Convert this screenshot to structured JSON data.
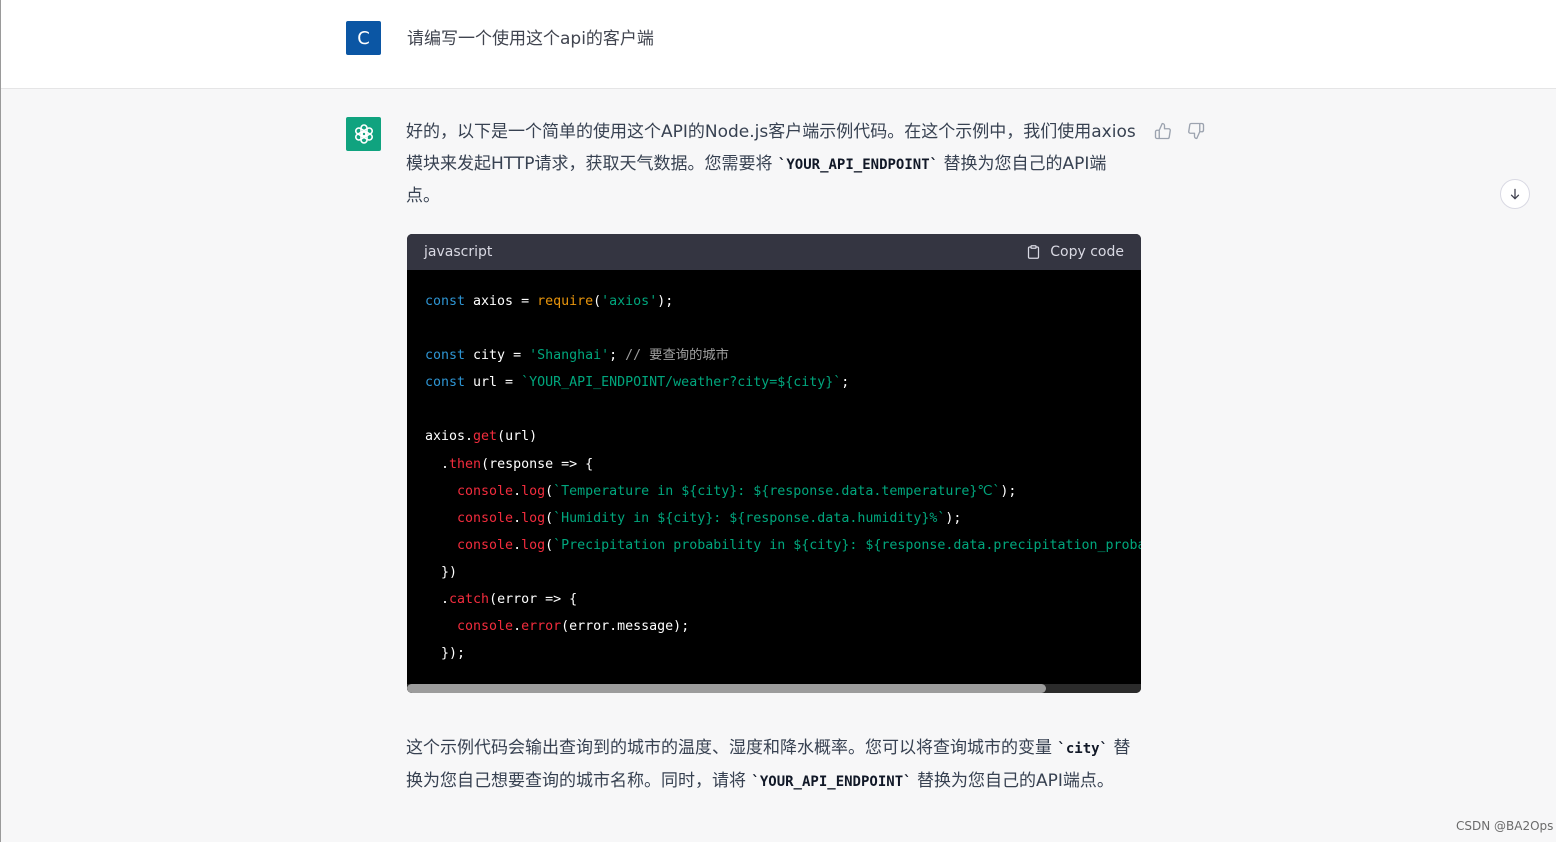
{
  "user_message": {
    "avatar_letter": "C",
    "text": "请编写一个使用这个api的客户端"
  },
  "assistant_message": {
    "intro": {
      "before": "好的，以下是一个简单的使用这个API的Node.js客户端示例代码。在这个示例中，我们使用axios模块来发起HTTP请求，获取天气数据。您需要将 ",
      "code": "`YOUR_API_ENDPOINT`",
      "after": " 替换为您自己的API端点。"
    },
    "code_block": {
      "language": "javascript",
      "copy_label": "Copy code",
      "scroll_position": 0.87
    },
    "outro": {
      "before": "这个示例代码会输出查询到的城市的温度、湿度和降水概率。您可以将查询城市的变量 ",
      "code1": "`city`",
      "middle": " 替换为您自己想要查询的城市名称。同时，请将 ",
      "code2": "`YOUR_API_ENDPOINT`",
      "after": " 替换为您自己的API端点。"
    }
  },
  "code": {
    "l1_kw": "const",
    "l1_a": " axios = ",
    "l1_fn": "require",
    "l1_b": "(",
    "l1_str": "'axios'",
    "l1_c": ");",
    "l3_kw": "const",
    "l3_a": " city = ",
    "l3_str": "'Shanghai'",
    "l3_b": "; ",
    "l3_cmt": "// 要查询的城市",
    "l4_kw": "const",
    "l4_a": " url = ",
    "l4_str": "`YOUR_API_ENDPOINT/weather?city=${city}`",
    "l4_b": ";",
    "l6_a": "axios.",
    "l6_fn": "get",
    "l6_b": "(url)",
    "l7_a": "  .",
    "l7_fn": "then",
    "l7_b": "(response => {",
    "l8_obj": "    console",
    "l8_dot": ".",
    "l8_fn": "log",
    "l8_p": "(",
    "l8_str": "`Temperature in ${city}: ${response.data.temperature}℃`",
    "l8_end": ");",
    "l9_obj": "    console",
    "l9_dot": ".",
    "l9_fn": "log",
    "l9_p": "(",
    "l9_str": "`Humidity in ${city}: ${response.data.humidity}%`",
    "l9_end": ");",
    "l10_obj": "    console",
    "l10_dot": ".",
    "l10_fn": "log",
    "l10_p": "(",
    "l10_str": "`Precipitation probability in ${city}: ${response.data.precipitation_proba",
    "l11": "  })",
    "l12_a": "  .",
    "l12_fn": "catch",
    "l12_b": "(error => {",
    "l13_obj": "    console",
    "l13_dot": ".",
    "l13_fn": "error",
    "l13_b": "(error.message);",
    "l14": "  });"
  },
  "watermark": "CSDN @BA2Ops",
  "colors": {
    "user_avatar": "#0b56a4",
    "bot_avatar": "#10a37f",
    "code_background": "#000000",
    "code_header": "#343541",
    "keyword": "#2e95d3",
    "string": "#00a67d",
    "function": "#f22c3d",
    "builtin": "#e9950c",
    "comment": "#9e9e9e"
  },
  "icons": {
    "bot_avatar": "openai-logo-icon",
    "thumb_up": "thumbs-up-icon",
    "thumb_down": "thumbs-down-icon",
    "copy": "clipboard-icon",
    "scroll": "arrow-down-icon"
  }
}
